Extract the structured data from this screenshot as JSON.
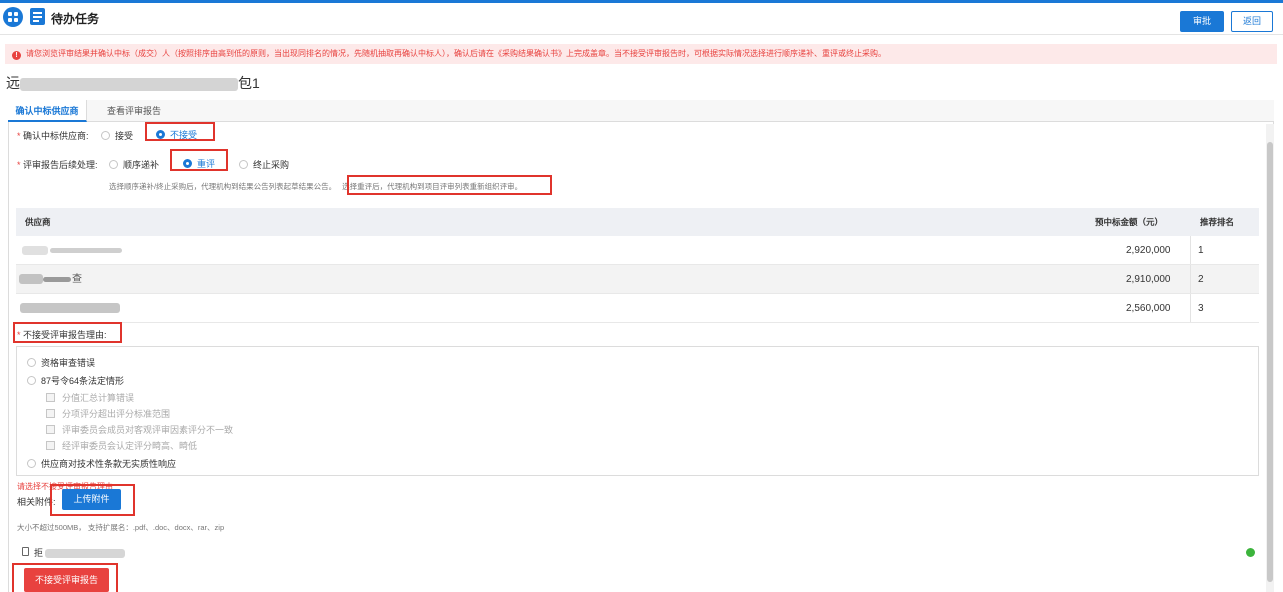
{
  "header": {
    "title": "待办任务",
    "approve_label": "审批",
    "back_label": "返回"
  },
  "alert": {
    "icon": "!",
    "text": "请您浏览评审结果并确认中标（成交）人（按照排序由高到低的原则，当出现同排名的情况，先随机抽取再确认中标人），确认后请在《采购结果确认书》上完成盖章。当不接受评审报告时，可根据实际情况选择进行顺序递补、重评或终止采购。"
  },
  "project": {
    "title_prefix": "远",
    "title_suffix": "包1"
  },
  "tabs": [
    {
      "label": "确认中标供应商",
      "active": true
    },
    {
      "label": "查看评审报告",
      "active": false
    }
  ],
  "confirm_supplier": {
    "required_mark": "*",
    "label": "确认中标供应商:",
    "options": [
      {
        "label": "接受",
        "checked": false
      },
      {
        "label": "不接受",
        "checked": true
      }
    ]
  },
  "followup": {
    "required_mark": "*",
    "label": "评审报告后续处理:",
    "options": [
      {
        "label": "顺序递补",
        "checked": false
      },
      {
        "label": "重评",
        "checked": true
      },
      {
        "label": "终止采购",
        "checked": false
      }
    ],
    "hint_1": "选择顺序递补/终止采购后，代理机构到结果公告列表起草结果公告。",
    "hint_2": "选择重评后，代理机构到项目评审列表重新组织评审。"
  },
  "table": {
    "columns": [
      "供应商",
      "预中标金额（元）",
      "推荐排名"
    ],
    "rows": [
      {
        "supplier_suffix": "",
        "amount": "2,920,000",
        "rank": "1"
      },
      {
        "supplier_suffix": "查",
        "amount": "2,910,000",
        "rank": "2"
      },
      {
        "supplier_suffix": "",
        "amount": "2,560,000",
        "rank": "3"
      }
    ]
  },
  "reject_reason": {
    "required_mark": "*",
    "label": "不接受评审报告理由:",
    "options": [
      {
        "label": "资格审查错误",
        "type": "radio"
      },
      {
        "label": "87号令64条法定情形",
        "type": "radio"
      },
      {
        "label": "分值汇总计算错误",
        "type": "checkbox"
      },
      {
        "label": "分项评分超出评分标准范围",
        "type": "checkbox"
      },
      {
        "label": "评审委员会成员对客观评审因素评分不一致",
        "type": "checkbox"
      },
      {
        "label": "经评审委员会认定评分畸高、畸低",
        "type": "checkbox"
      },
      {
        "label": "供应商对技术性条款无实质性响应",
        "type": "radio"
      }
    ],
    "error_text": "请选择不接受评审报告理由"
  },
  "attachment": {
    "label": "相关附件:",
    "upload_label": "上传附件",
    "hint": "大小不超过500MB， 支持扩展名：.pdf、.doc、docx、rar、zip",
    "file_prefix": "拒"
  },
  "submit": {
    "reject_label": "不接受评审报告"
  },
  "colors": {
    "primary": "#1a78d6",
    "danger": "#e8423f",
    "highlight_box": "#e0342c",
    "success": "#3cb43c"
  }
}
